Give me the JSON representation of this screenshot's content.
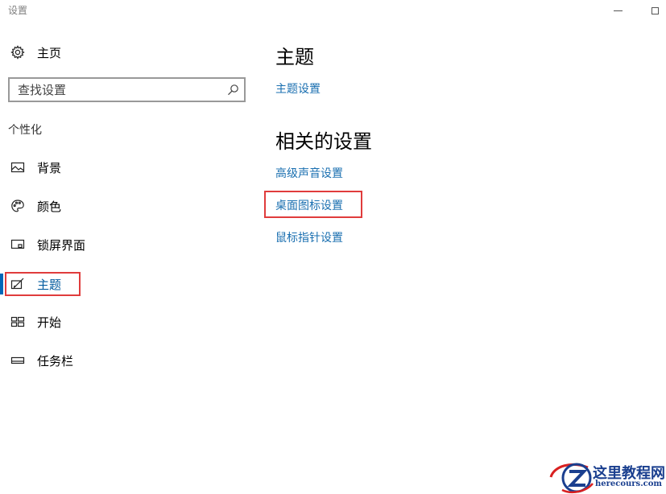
{
  "window": {
    "title": "设置"
  },
  "sidebar": {
    "home_label": "主页",
    "search_placeholder": "查找设置",
    "section_label": "个性化",
    "items": [
      {
        "label": "背景",
        "icon": "image-icon"
      },
      {
        "label": "颜色",
        "icon": "palette-icon"
      },
      {
        "label": "锁屏界面",
        "icon": "lock-screen-icon"
      },
      {
        "label": "主题",
        "icon": "theme-brush-icon",
        "active": true
      },
      {
        "label": "开始",
        "icon": "start-grid-icon"
      },
      {
        "label": "任务栏",
        "icon": "taskbar-icon"
      }
    ]
  },
  "main": {
    "title": "主题",
    "theme_link": "主题设置",
    "related_title": "相关的设置",
    "related_links": [
      {
        "label": "高级声音设置"
      },
      {
        "label": "桌面图标设置",
        "highlighted": true
      },
      {
        "label": "鼠标指针设置"
      }
    ]
  },
  "watermark": {
    "name": "这里教程网",
    "url": "herecours.com"
  },
  "colors": {
    "accent": "#0067b8",
    "link": "#1a6fb0",
    "highlight_box": "#e03c3c"
  }
}
